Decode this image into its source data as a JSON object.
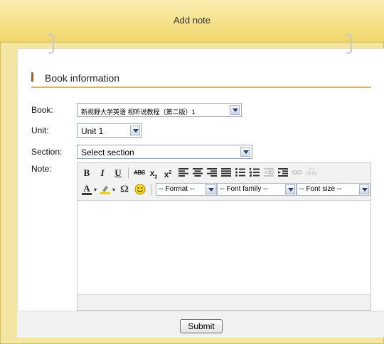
{
  "header": {
    "title": "Add note"
  },
  "section": {
    "title": "Book information"
  },
  "form": {
    "book": {
      "label": "Book:",
      "value": "新视野大学英语 视听说教程（第二版）1"
    },
    "unit": {
      "label": "Unit:",
      "value": "Unit 1"
    },
    "section": {
      "label": "Section:",
      "value": "Select section"
    },
    "note": {
      "label": "Note:"
    }
  },
  "toolbar": {
    "bold": "B",
    "italic": "I",
    "underline": "U",
    "strikethrough": "ABC",
    "subscript": "x",
    "superscript": "x",
    "omega": "Ω",
    "format": "-- Format --",
    "font_family": "-- Font family --",
    "font_size": "-- Font size --"
  },
  "footer": {
    "submit_label": "Submit"
  },
  "colors": {
    "header_bg": "#efd56a",
    "frame_bg": "#f3e6a2",
    "section_accent": "#a45f1c",
    "section_rule": "#e3b554",
    "select_arrow": "#2b3c63",
    "font_color_underline": "#3a3a3a",
    "highlight_underline": "#f0d000"
  }
}
